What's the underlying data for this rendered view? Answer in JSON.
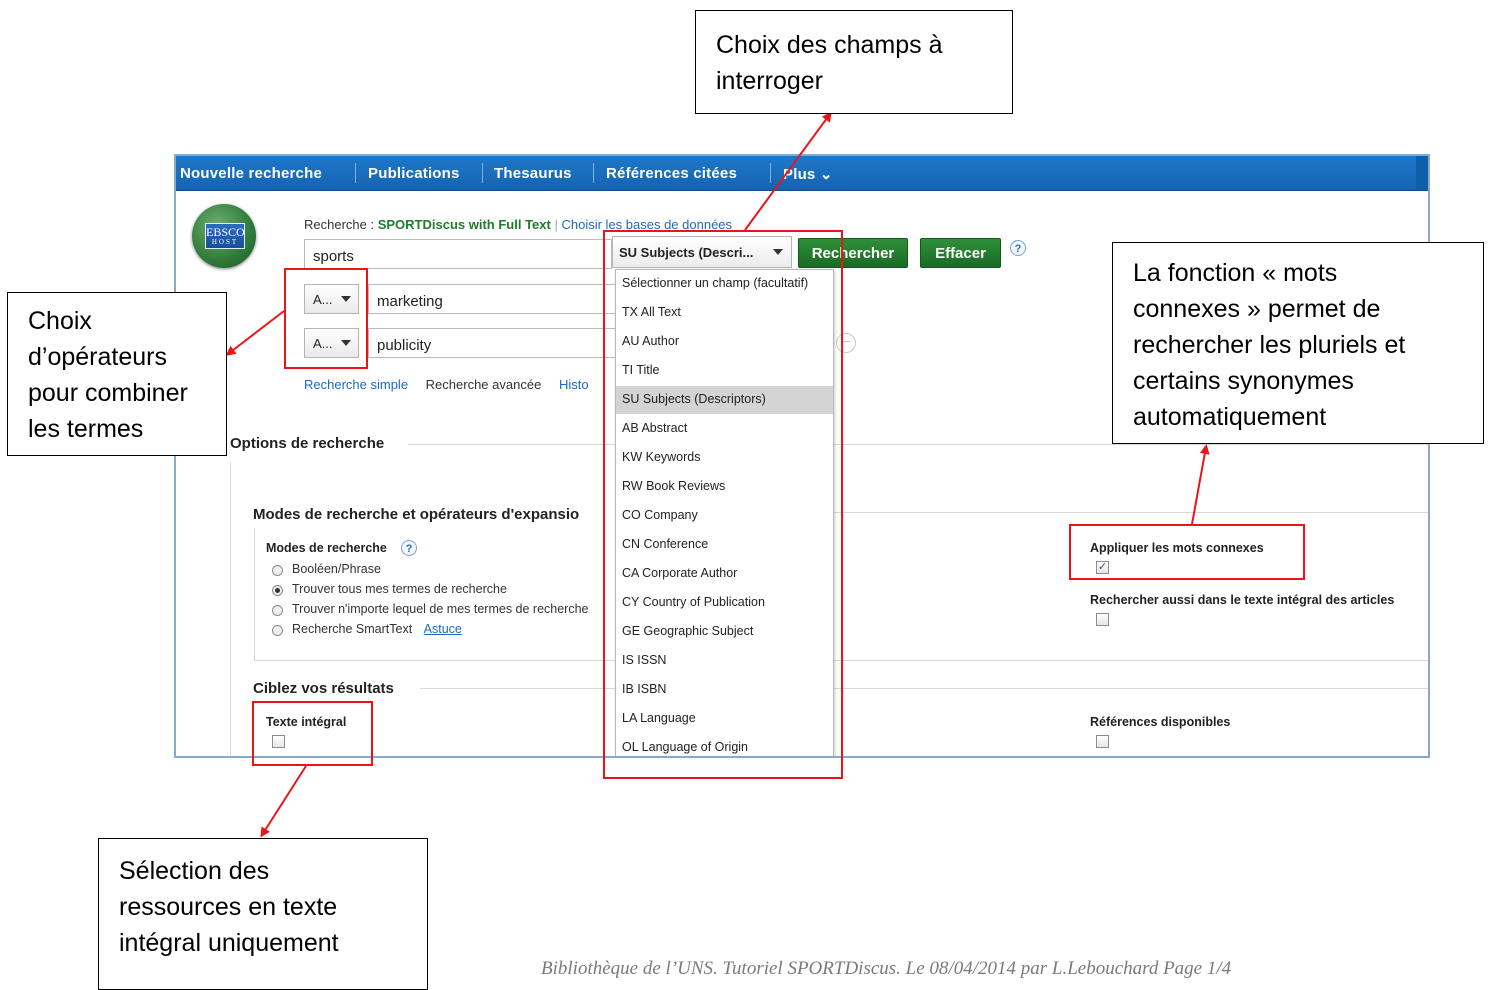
{
  "nav": {
    "items": [
      "Nouvelle recherche",
      "Publications",
      "Thesaurus",
      "Références citées",
      "Plus ⌄"
    ]
  },
  "logo": {
    "top": "EBSCO",
    "bottom": "HOST"
  },
  "search": {
    "label": "Recherche :",
    "database": "SPORTDiscus with Full Text",
    "choose_db": "Choisir les bases de données",
    "row1_value": "sports",
    "row2_operator": "A...",
    "row2_value": "marketing",
    "row3_operator": "A...",
    "row3_value": "publicity",
    "field_select": "SU Subjects (Descri...",
    "search_button": "Rechercher",
    "clear_button": "Effacer",
    "help": "?",
    "minus": "−"
  },
  "search_links": {
    "simple": "Recherche simple",
    "advanced": "Recherche avancée",
    "history": "Histo"
  },
  "field_options": [
    "Sélectionner un champ (facultatif)",
    "TX All Text",
    "AU Author",
    "TI Title",
    "SU Subjects (Descriptors)",
    "AB Abstract",
    "KW Keywords",
    "RW Book Reviews",
    "CO Company",
    "CN Conference",
    "CA Corporate Author",
    "CY Country of Publication",
    "GE Geographic Subject",
    "IS ISSN",
    "IB ISBN",
    "LA Language",
    "OL Language of Origin"
  ],
  "options": {
    "title": "Options de recherche",
    "modes_title": "Modes de recherche et opérateurs d'expansio",
    "modes_label": "Modes de recherche",
    "mode_items": [
      "Booléen/Phrase",
      "Trouver tous mes termes de recherche",
      "Trouver n'importe lequel de mes termes de recherche",
      "Recherche SmartText"
    ],
    "astuce": "Astuce",
    "related_words": "Appliquer les mots connexes",
    "fulltext_search": "Rechercher aussi dans le texte intégral des articles",
    "target_title": "Ciblez vos résultats",
    "full_text": "Texte intégral",
    "references": "Références disponibles"
  },
  "callouts": {
    "fields": [
      "Choix des champs à",
      "interroger"
    ],
    "operators": [
      "Choix",
      "d’opérateurs",
      "pour combiner",
      "les termes"
    ],
    "related": [
      "La fonction « mots",
      "connexes » permet de",
      "rechercher les pluriels et",
      "certains synonymes",
      "automatiquement"
    ],
    "fulltext": [
      "Sélection des",
      "ressources en texte",
      "intégral uniquement"
    ]
  },
  "footer": "Bibliothèque de l’UNS. Tutoriel SPORTDiscus. Le 08/04/2014  par L.Lebouchard           Page 1/4"
}
